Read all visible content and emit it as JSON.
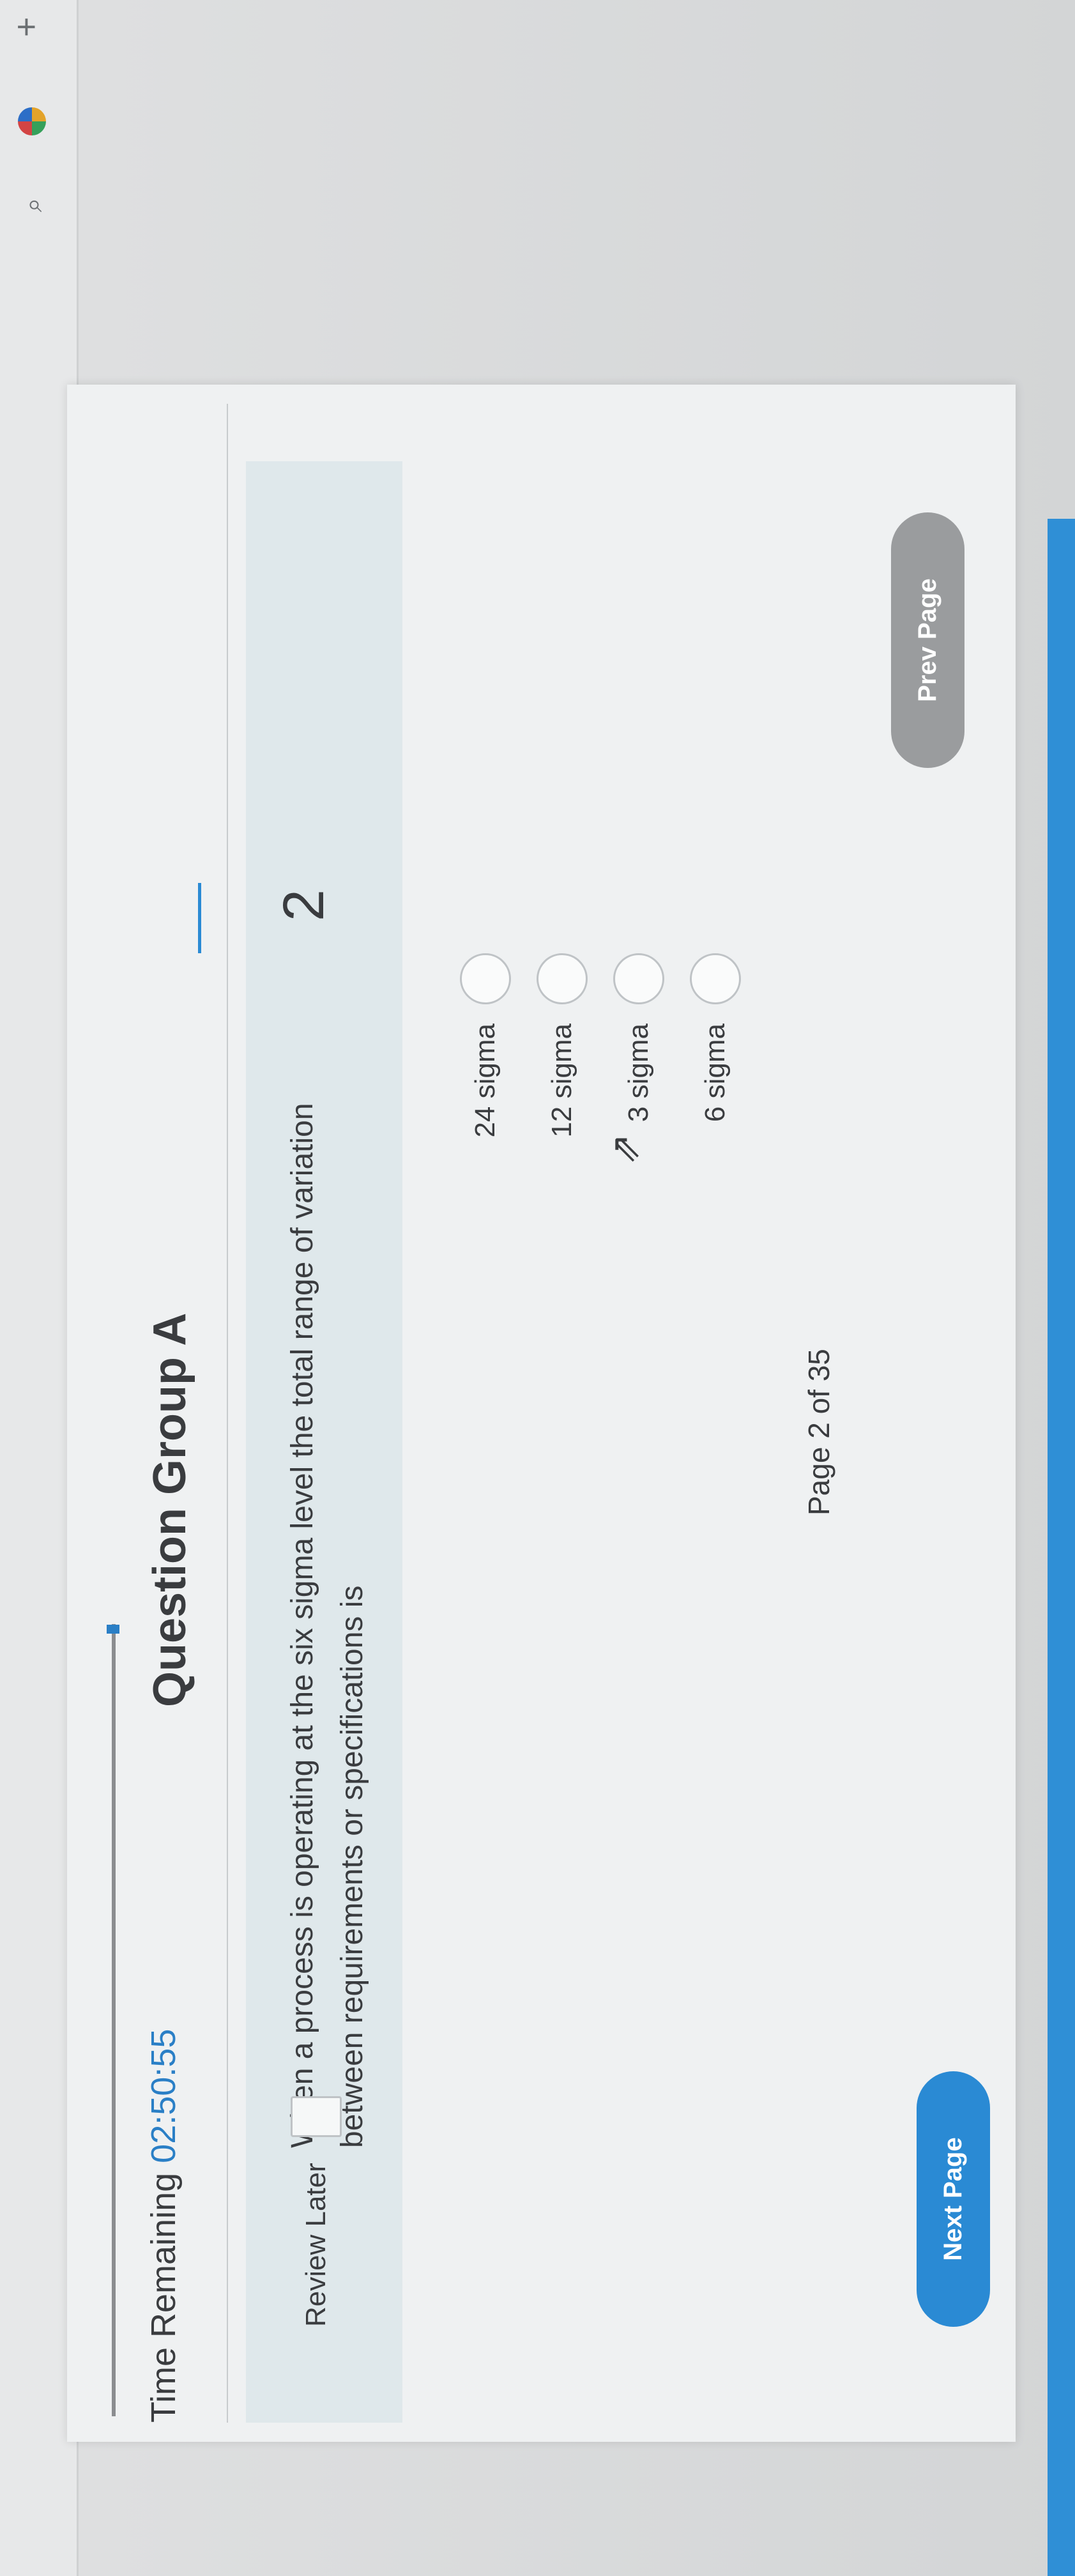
{
  "browser": {
    "new_tab_icon": "plus-icon",
    "extension_icon": "extension-icon",
    "search_icon": "search-icon"
  },
  "header": {
    "group_title": "Question Group A",
    "time_label": "Time Remaining",
    "time_value": "02:50:55"
  },
  "question": {
    "number": "2",
    "text": "When a process is operating at the six sigma level the total range of variation between requirements or specifications is",
    "review_label": "Review Later"
  },
  "options": [
    {
      "label": "24 sigma"
    },
    {
      "label": "12 sigma"
    },
    {
      "label": "3 sigma"
    },
    {
      "label": "6 sigma"
    }
  ],
  "footer": {
    "page_indicator": "Page 2 of 35",
    "prev_label": "Prev Page",
    "next_label": "Next Page"
  },
  "colors": {
    "accent": "#2a8ad4",
    "prev_button": "#9a9c9e",
    "panel": "#dfe8eb"
  }
}
